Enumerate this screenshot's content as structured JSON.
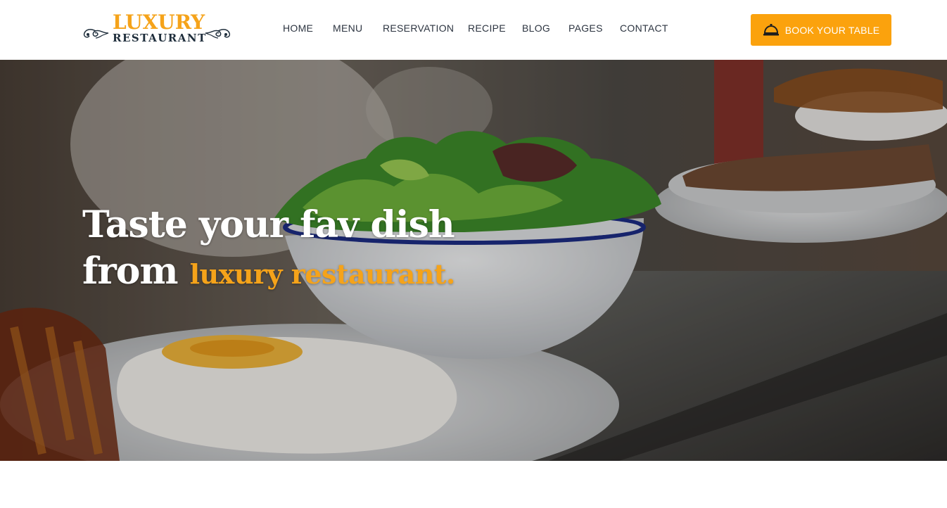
{
  "brand": {
    "line1": "LUXURY",
    "line2": "RESTAURANT",
    "primary_color": "#f5a31a",
    "dark_color": "#1e2d3b"
  },
  "nav": {
    "items": [
      {
        "label": "HOME"
      },
      {
        "label": "MENU"
      },
      {
        "label": "RESERVATION"
      },
      {
        "label": "RECIPE"
      },
      {
        "label": "BLOG"
      },
      {
        "label": "PAGES"
      },
      {
        "label": "CONTACT"
      }
    ]
  },
  "cta": {
    "label": "BOOK YOUR TABLE",
    "icon": "service-bell-icon",
    "color": "#fba20d"
  },
  "hero": {
    "line1": "Taste your fav dish",
    "line2_prefix": "from",
    "line2_accent": "luxury restaurant."
  }
}
